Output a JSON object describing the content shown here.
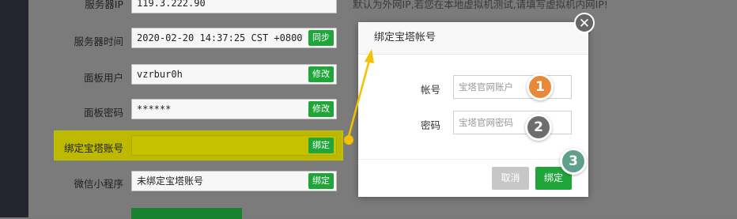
{
  "form": {
    "server_ip_label": "服务器IP",
    "server_ip_value": "119.3.222.90",
    "server_ip_hint": "默认为外网IP,若您在本地虚拟机测试,请填写虚拟机内网IP!",
    "server_time_label": "服务器时间",
    "server_time_value": "2020-02-20 14:37:25 CST +0800",
    "server_time_button": "同步",
    "panel_user_label": "面板用户",
    "panel_user_value": "vzrbur0h",
    "panel_user_button": "修改",
    "panel_password_label": "面板密码",
    "panel_password_value": "******",
    "panel_password_button": "修改",
    "bind_account_label": "绑定宝塔账号",
    "bind_account_value": "",
    "bind_account_button": "绑定",
    "wechat_label": "微信小程序",
    "wechat_value": "未绑定宝塔账号",
    "wechat_button": "绑定"
  },
  "modal": {
    "title": "绑定宝塔帐号",
    "close_symbol": "✕",
    "account_label": "帐号",
    "account_placeholder": "宝塔官网账户",
    "password_label": "密码",
    "password_placeholder": "宝塔官网密码",
    "cancel_button": "取消",
    "bind_button": "绑定"
  },
  "annotations": {
    "step1": "1",
    "step2": "2",
    "step3": "3",
    "step1_color": "#e8893a",
    "step2_color": "#6d6d6d",
    "step3_color": "#5f9f8c",
    "arrow_color": "#f5c000"
  }
}
